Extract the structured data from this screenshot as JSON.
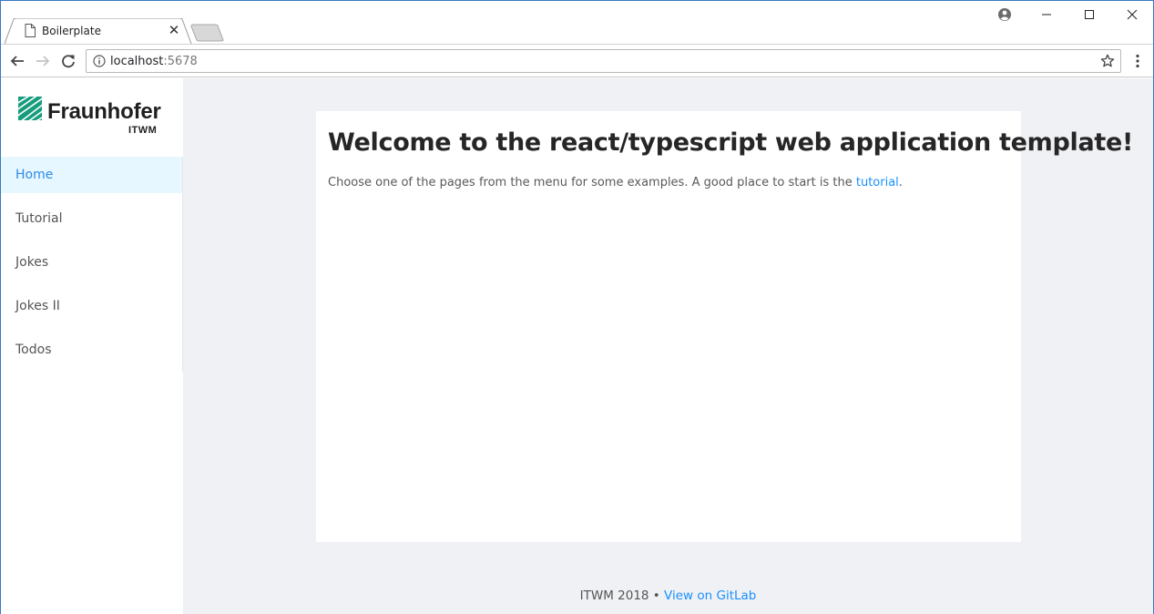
{
  "browser": {
    "tab": {
      "title": "Boilerplate",
      "close_glyph": "✕"
    },
    "address": {
      "host": "localhost",
      "port": ":5678"
    },
    "colors": {
      "window_border": "#3b78c4",
      "link": "#1890ff"
    }
  },
  "sidebar": {
    "logo": {
      "name": "Fraunhofer",
      "sub": "ITWM",
      "mark_color": "#179c7d"
    },
    "items": [
      {
        "label": "Home",
        "active": true
      },
      {
        "label": "Tutorial",
        "active": false
      },
      {
        "label": "Jokes",
        "active": false
      },
      {
        "label": "Jokes II",
        "active": false
      },
      {
        "label": "Todos",
        "active": false
      }
    ]
  },
  "main": {
    "title": "Welcome to the react/typescript web application template!",
    "intro_before": "Choose one of the pages from the menu for some examples. A good place to start is the ",
    "intro_link": "tutorial",
    "intro_after": "."
  },
  "footer": {
    "text": "ITWM 2018 • ",
    "link": "View on GitLab"
  }
}
